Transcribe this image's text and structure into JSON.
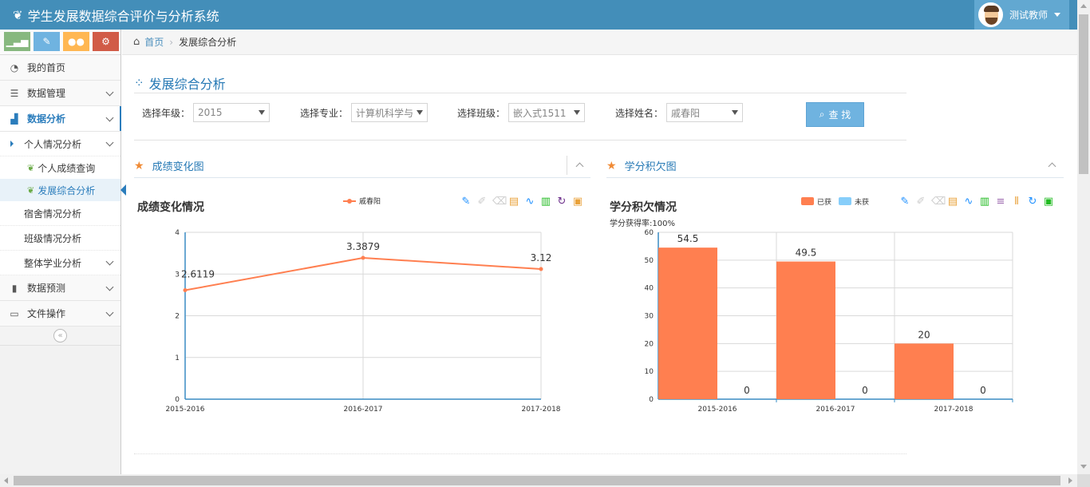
{
  "app": {
    "title": "学生发展数据综合评价与分析系统",
    "user_name": "测试教师"
  },
  "shortcuts": [
    {
      "icon": "signal-icon",
      "color": "#87b87f"
    },
    {
      "icon": "pencil-icon",
      "color": "#6fb3e0"
    },
    {
      "icon": "users-icon",
      "color": "#ffb752"
    },
    {
      "icon": "cogs-icon",
      "color": "#d15b47"
    }
  ],
  "sidebar": {
    "home": "我的首页",
    "data_mgmt": "数据管理",
    "data_analysis": "数据分析",
    "personal_analysis": "个人情况分析",
    "personal_score": "个人成绩查询",
    "dev_analysis": "发展综合分析",
    "dorm_analysis": "宿舍情况分析",
    "class_analysis": "班级情况分析",
    "overall_analysis": "整体学业分析",
    "data_predict": "数据预测",
    "file_ops": "文件操作"
  },
  "breadcrumb": {
    "home": "首页",
    "current": "发展综合分析"
  },
  "page": {
    "title": "发展综合分析"
  },
  "filters": {
    "grade": {
      "label": "选择年级：",
      "value": "2015"
    },
    "major": {
      "label": "选择专业：",
      "value": "计算机科学与"
    },
    "class": {
      "label": "选择班级：",
      "value": "嵌入式1511"
    },
    "name": {
      "label": "选择姓名：",
      "value": "戚春阳"
    },
    "search_label": "查 找"
  },
  "widgets": {
    "score": {
      "header": "成绩变化图"
    },
    "credit": {
      "header": "学分积欠图"
    }
  },
  "chart_data": [
    {
      "type": "line",
      "title": "成绩变化情况",
      "categories": [
        "2015-2016",
        "2016-2017",
        "2017-2018"
      ],
      "series": [
        {
          "name": "戚春阳",
          "values": [
            2.6119,
            3.3879,
            3.12
          ],
          "color": "#ff7f50"
        }
      ],
      "value_labels": [
        "2.6119",
        "3.3879",
        "3.12"
      ],
      "ylim": [
        0,
        4
      ],
      "yticks": [
        0,
        1,
        2,
        3,
        4
      ],
      "grid": true,
      "legend": "top-center"
    },
    {
      "type": "bar",
      "title": "学分积欠情况",
      "subtitle": "学分获得率:100%",
      "categories": [
        "2015-2016",
        "2016-2017",
        "2017-2018"
      ],
      "series": [
        {
          "name": "已获",
          "values": [
            54.5,
            49.5,
            20
          ],
          "color": "#ff7f50"
        },
        {
          "name": "未获",
          "values": [
            0,
            0,
            0
          ],
          "color": "#87cefa"
        }
      ],
      "value_labels": [
        [
          "54.5",
          "49.5",
          "20"
        ],
        [
          "0",
          "0",
          "0"
        ]
      ],
      "ylim": [
        0,
        60
      ],
      "yticks": [
        0,
        10,
        20,
        30,
        40,
        50,
        60
      ],
      "grid": true,
      "legend": "top-center"
    }
  ],
  "toolbox": {
    "line": [
      {
        "icon": "mark-icon",
        "color": "#1e90ff"
      },
      {
        "icon": "mark-undo-icon",
        "color": "#cccccc"
      },
      {
        "icon": "mark-clear-icon",
        "color": "#cccccc"
      },
      {
        "icon": "data-view-icon",
        "color": "#e9a23b"
      },
      {
        "icon": "line-switch-icon",
        "color": "#1e90ff"
      },
      {
        "icon": "bar-switch-icon",
        "color": "#22bb22"
      },
      {
        "icon": "restore-icon",
        "color": "#6b2d8a"
      },
      {
        "icon": "save-image-icon",
        "color": "#e9a23b"
      }
    ],
    "bar": [
      {
        "icon": "mark-icon",
        "color": "#1e90ff"
      },
      {
        "icon": "mark-undo-icon",
        "color": "#cccccc"
      },
      {
        "icon": "mark-clear-icon",
        "color": "#cccccc"
      },
      {
        "icon": "data-view-icon",
        "color": "#e9a23b"
      },
      {
        "icon": "line-switch-icon",
        "color": "#1e90ff"
      },
      {
        "icon": "bar-switch-icon",
        "color": "#22bb22"
      },
      {
        "icon": "stack-icon",
        "color": "#9e6bb0"
      },
      {
        "icon": "tiled-icon",
        "color": "#e9a23b"
      },
      {
        "icon": "restore-icon",
        "color": "#1e90ff"
      },
      {
        "icon": "save-image-icon",
        "color": "#22bb22"
      }
    ]
  }
}
